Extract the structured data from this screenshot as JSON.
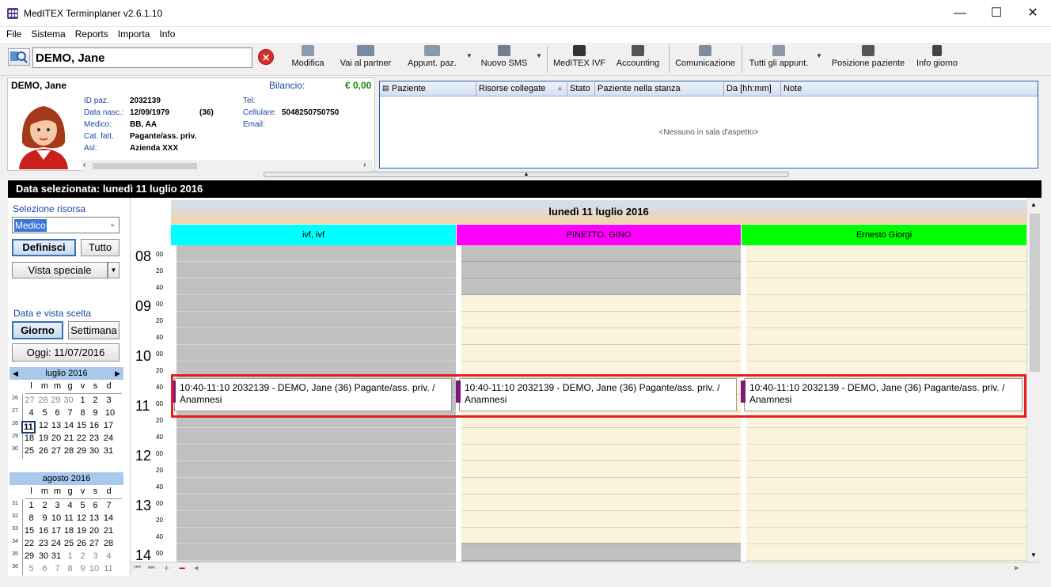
{
  "app": {
    "title": "MedITEX Terminplaner  v2.6.1.10"
  },
  "window": {
    "minimize": "—",
    "maximize": "☐",
    "close": "✕"
  },
  "menu": [
    "File",
    "Sistema",
    "Reports",
    "Importa",
    "Info"
  ],
  "search": {
    "value": "DEMO, Jane"
  },
  "toolbar": {
    "buttons": [
      {
        "label": "Modifica",
        "icon": "edit-icon"
      },
      {
        "label": "Vai al partner",
        "icon": "partner-icon"
      },
      {
        "label": "Appunt. paz.",
        "icon": "appointments-icon"
      },
      {
        "label": "Nuovo SMS",
        "icon": "sms-icon"
      },
      {
        "label": "MedITEX IVF",
        "icon": "ivf-icon"
      },
      {
        "label": "Accounting",
        "icon": "accounting-icon"
      },
      {
        "label": "Comunicazione",
        "icon": "communication-icon"
      },
      {
        "label": "Tutti gli appunt.",
        "icon": "all-appointments-icon"
      },
      {
        "label": "Posizione paziente",
        "icon": "patient-position-icon"
      },
      {
        "label": "Info giorno",
        "icon": "day-info-icon"
      }
    ]
  },
  "patient": {
    "name": "DEMO, Jane",
    "balance_label": "Bilancio:",
    "balance": "€ 0,00",
    "id_label": "ID paz.",
    "id": "2032139",
    "dob_label": "Data nasc.:",
    "dob": "12/09/1979",
    "age": "(36)",
    "doctor_label": "Medico:",
    "doctor": "BB, AA",
    "billing_label": "Cat. fatt.",
    "billing": "Pagante/ass. priv.",
    "asl_label": "Asl:",
    "asl": "Azienda XXX",
    "tel_label": "Tel:",
    "tel": "",
    "cell_label": "Cellulare:",
    "cell": "5048250750750",
    "email_label": "Email:",
    "email": ""
  },
  "waiting_room": {
    "columns": [
      "Paziente",
      "Risorse collegate",
      "Stato",
      "Paziente nella stanza",
      "Da [hh:mm]",
      "Note"
    ],
    "empty": "<Nessuno in sala d'aspetto>"
  },
  "selected_date": "Data selezionata:  lunedì 11 luglio 2016",
  "left": {
    "resource_label": "Selezione risorsa",
    "resource_value": "Medico",
    "define": "Definisci",
    "all": "Tutto",
    "special_view": "Vista speciale",
    "date_view_label": "Data e vista scelta",
    "day": "Giorno",
    "week": "Settimana",
    "today": "Oggi: 11/07/2016"
  },
  "calendar_july": {
    "title": "luglio 2016",
    "days": [
      "l",
      "m",
      "m",
      "g",
      "v",
      "s",
      "d"
    ],
    "weeks": [
      {
        "wk": "26",
        "d": [
          "27",
          "28",
          "29",
          "30",
          "1",
          "2",
          "3"
        ]
      },
      {
        "wk": "27",
        "d": [
          "4",
          "5",
          "6",
          "7",
          "8",
          "9",
          "10"
        ]
      },
      {
        "wk": "28",
        "d": [
          "11",
          "12",
          "13",
          "14",
          "15",
          "16",
          "17"
        ]
      },
      {
        "wk": "29",
        "d": [
          "18",
          "19",
          "20",
          "21",
          "22",
          "23",
          "24"
        ]
      },
      {
        "wk": "30",
        "d": [
          "25",
          "26",
          "27",
          "28",
          "29",
          "30",
          "31"
        ]
      }
    ]
  },
  "calendar_aug": {
    "title": "agosto 2016",
    "days": [
      "l",
      "m",
      "m",
      "g",
      "v",
      "s",
      "d"
    ],
    "weeks": [
      {
        "wk": "31",
        "d": [
          "1",
          "2",
          "3",
          "4",
          "5",
          "6",
          "7"
        ]
      },
      {
        "wk": "32",
        "d": [
          "8",
          "9",
          "10",
          "11",
          "12",
          "13",
          "14"
        ]
      },
      {
        "wk": "33",
        "d": [
          "15",
          "16",
          "17",
          "18",
          "19",
          "20",
          "21"
        ]
      },
      {
        "wk": "34",
        "d": [
          "22",
          "23",
          "24",
          "25",
          "26",
          "27",
          "28"
        ]
      },
      {
        "wk": "35",
        "d": [
          "29",
          "30",
          "31",
          "1",
          "2",
          "3",
          "4"
        ]
      },
      {
        "wk": "36",
        "d": [
          "5",
          "6",
          "7",
          "8",
          "9",
          "10",
          "11"
        ]
      }
    ]
  },
  "schedule": {
    "day": "lunedì 11 luglio 2016",
    "resources": [
      {
        "name": "ivf, ivf",
        "color": "#00ffff"
      },
      {
        "name": "PINETTO, GINO",
        "color": "#ff00ff"
      },
      {
        "name": "Ernesto Giorgi",
        "color": "#00ff00"
      }
    ],
    "hours": [
      "08",
      "09",
      "10",
      "11",
      "12",
      "13",
      "14"
    ],
    "minutes": [
      "00",
      "20",
      "40"
    ],
    "appointment": "10:40-11:10 2032139 - DEMO, Jane (36) Pagante/ass. priv. / Anamnesi"
  }
}
